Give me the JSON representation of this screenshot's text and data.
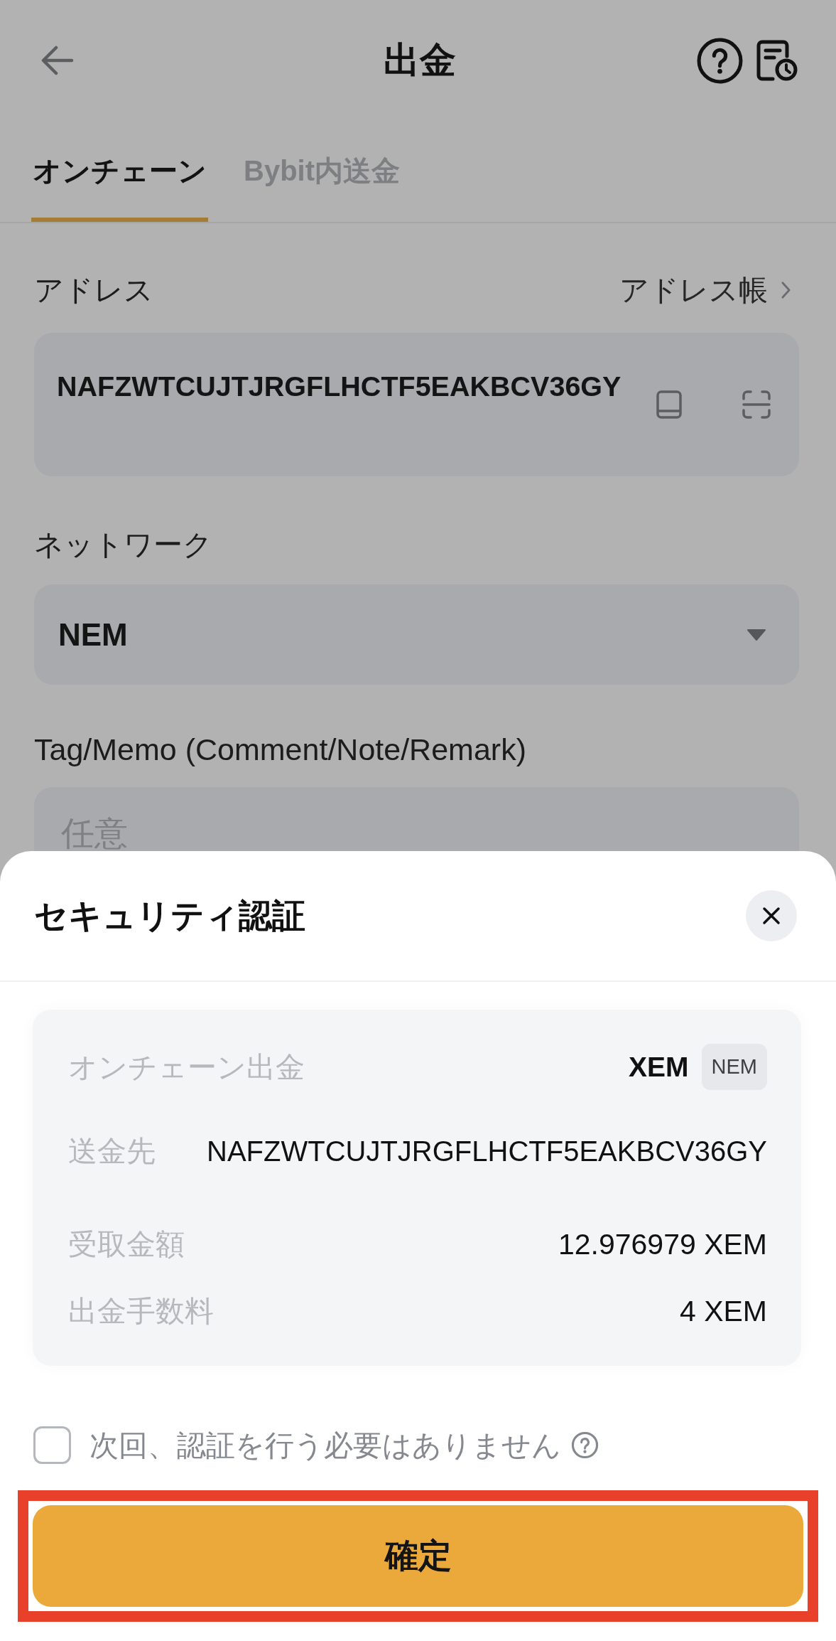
{
  "header": {
    "title": "出金"
  },
  "tabs": [
    {
      "label": "オンチェーン",
      "selected": true
    },
    {
      "label": "Bybit内送金",
      "selected": false
    }
  ],
  "address": {
    "label": "アドレス",
    "link": "アドレス帳",
    "value": "NAFZWTCUJTJRGFLHCTF5EAKBCV36GY"
  },
  "network": {
    "label": "ネットワーク",
    "value": "NEM"
  },
  "memo": {
    "label": "Tag/Memo (Comment/Note/Remark)",
    "placeholder": "任意"
  },
  "security_sheet": {
    "title": "セキュリティ認証",
    "summary": [
      {
        "kind": "asset",
        "label": "オンチェーン出金",
        "value": "XEM",
        "badge": "NEM"
      },
      {
        "kind": "address",
        "label": "送金先",
        "value": "NAFZWTCUJTJRGFLHCTF5EAKBCV36GY"
      },
      {
        "kind": "amount",
        "label": "受取金額",
        "value": "12.976979 XEM"
      },
      {
        "kind": "amount",
        "label": "出金手数料",
        "value": "4 XEM"
      }
    ],
    "skip_verification": {
      "label": "次回、認証を行う必要はありません",
      "checked": false
    },
    "confirm_button": {
      "label": "確定",
      "highlighted": true
    }
  }
}
